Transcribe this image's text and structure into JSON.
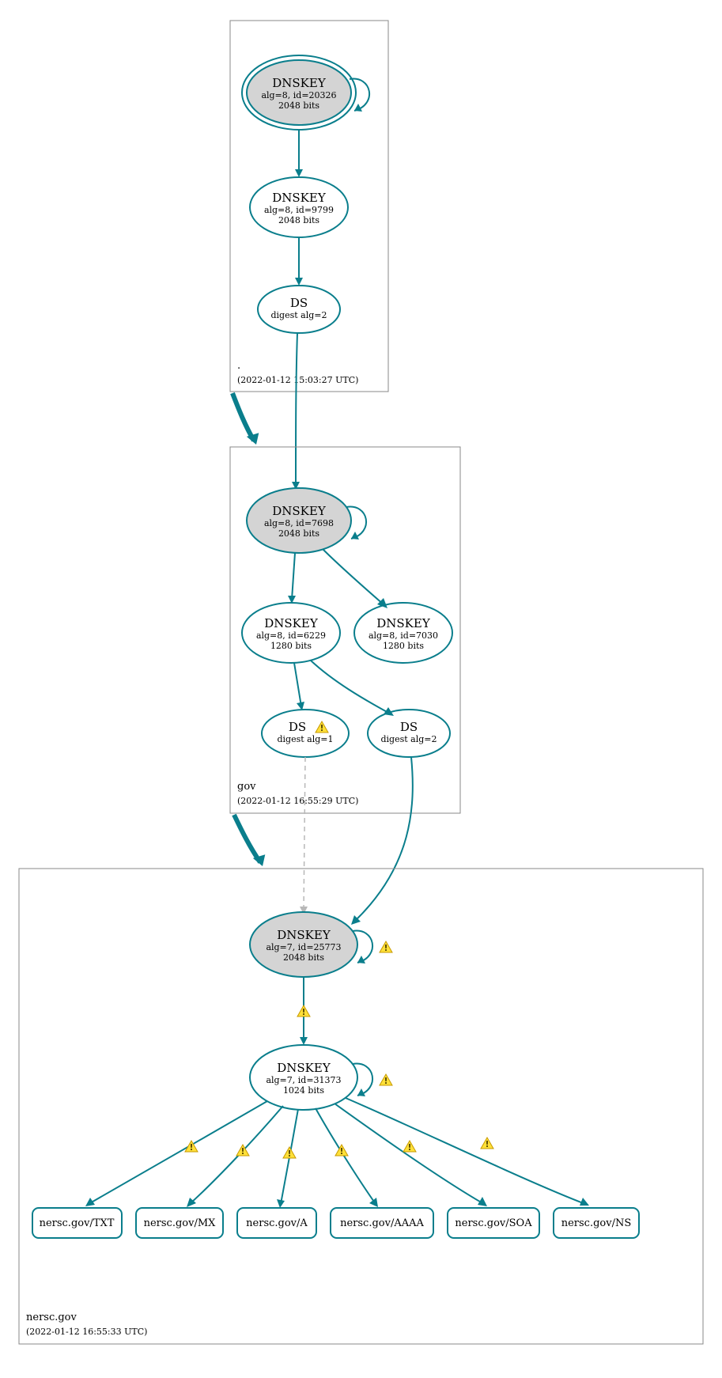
{
  "zones": {
    "root": {
      "name": ".",
      "timestamp": "(2022-01-12 15:03:27 UTC)",
      "nodes": {
        "ksk": {
          "title": "DNSKEY",
          "l1": "alg=8, id=20326",
          "l2": "2048 bits"
        },
        "zsk": {
          "title": "DNSKEY",
          "l1": "alg=8, id=9799",
          "l2": "2048 bits"
        },
        "ds": {
          "title": "DS",
          "l1": "digest alg=2"
        }
      }
    },
    "gov": {
      "name": "gov",
      "timestamp": "(2022-01-12 16:55:29 UTC)",
      "nodes": {
        "ksk": {
          "title": "DNSKEY",
          "l1": "alg=8, id=7698",
          "l2": "2048 bits"
        },
        "zsk1": {
          "title": "DNSKEY",
          "l1": "alg=8, id=6229",
          "l2": "1280 bits"
        },
        "zsk2": {
          "title": "DNSKEY",
          "l1": "alg=8, id=7030",
          "l2": "1280 bits"
        },
        "ds1": {
          "title": "DS",
          "l1": "digest alg=1"
        },
        "ds2": {
          "title": "DS",
          "l1": "digest alg=2"
        }
      }
    },
    "nersc": {
      "name": "nersc.gov",
      "timestamp": "(2022-01-12 16:55:33 UTC)",
      "nodes": {
        "ksk": {
          "title": "DNSKEY",
          "l1": "alg=7, id=25773",
          "l2": "2048 bits"
        },
        "zsk": {
          "title": "DNSKEY",
          "l1": "alg=7, id=31373",
          "l2": "1024 bits"
        }
      },
      "records": {
        "txt": "nersc.gov/TXT",
        "mx": "nersc.gov/MX",
        "a": "nersc.gov/A",
        "aaaa": "nersc.gov/AAAA",
        "soa": "nersc.gov/SOA",
        "ns": "nersc.gov/NS"
      }
    }
  }
}
